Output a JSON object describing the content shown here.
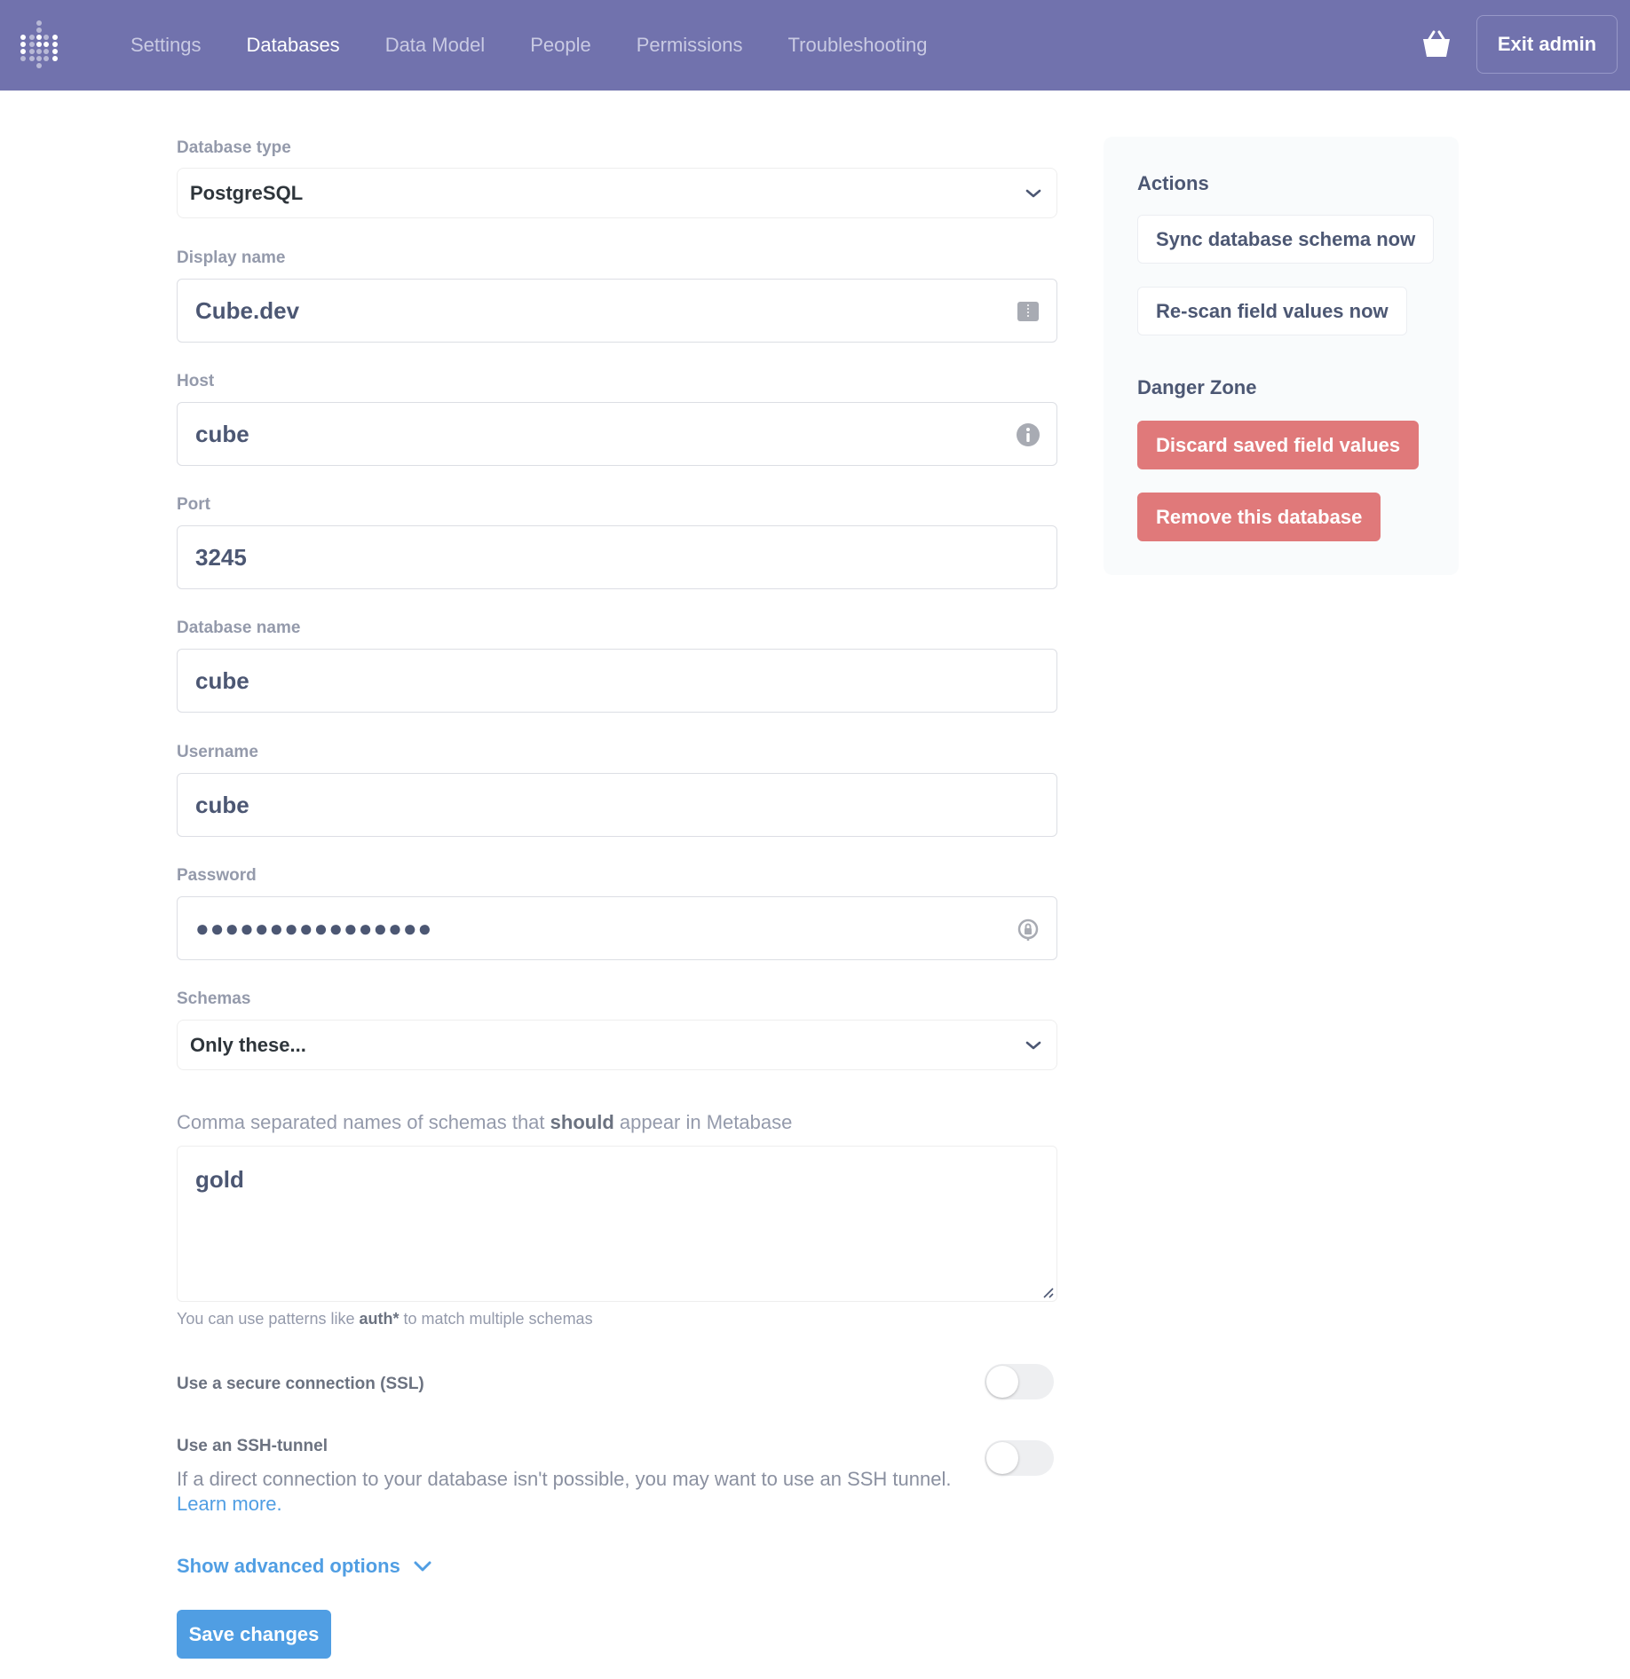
{
  "nav": {
    "items": [
      "Settings",
      "Databases",
      "Data Model",
      "People",
      "Permissions",
      "Troubleshooting"
    ],
    "active": "Databases",
    "exit_label": "Exit admin",
    "logo_icon": "metabase-logo-icon",
    "basket_icon": "basket-icon"
  },
  "form": {
    "database_type": {
      "label": "Database type",
      "value": "PostgreSQL"
    },
    "display_name": {
      "label": "Display name",
      "value": "Cube.dev"
    },
    "host": {
      "label": "Host",
      "value": "cube"
    },
    "port": {
      "label": "Port",
      "value": "3245"
    },
    "database_name": {
      "label": "Database name",
      "value": "cube"
    },
    "username": {
      "label": "Username",
      "value": "cube"
    },
    "password": {
      "label": "Password",
      "value": "●●●●●●●●●●●●●●●●"
    },
    "schemas": {
      "label": "Schemas",
      "value": "Only these..."
    },
    "schema_filter": {
      "help_pre": "Comma separated names of schemas that ",
      "help_bold": "should",
      "help_post": " appear in Metabase",
      "value": "gold",
      "note_pre": "You can use patterns like ",
      "note_bold": "auth*",
      "note_post": " to match multiple schemas"
    },
    "ssl": {
      "label": "Use a secure connection (SSL)",
      "enabled": false
    },
    "ssh": {
      "label": "Use an SSH-tunnel",
      "enabled": false,
      "description": "If a direct connection to your database isn't possible, you may want to use an SSH tunnel.",
      "link": "Learn more."
    },
    "advanced_label": "Show advanced options",
    "save_label": "Save changes"
  },
  "actions": {
    "title": "Actions",
    "sync": "Sync database schema now",
    "rescan": "Re-scan field values now",
    "danger_title": "Danger Zone",
    "discard": "Discard saved field values",
    "remove": "Remove this database"
  },
  "colors": {
    "nav_bg": "#7172ad",
    "brand": "#509ee3",
    "danger": "#e0797a"
  }
}
